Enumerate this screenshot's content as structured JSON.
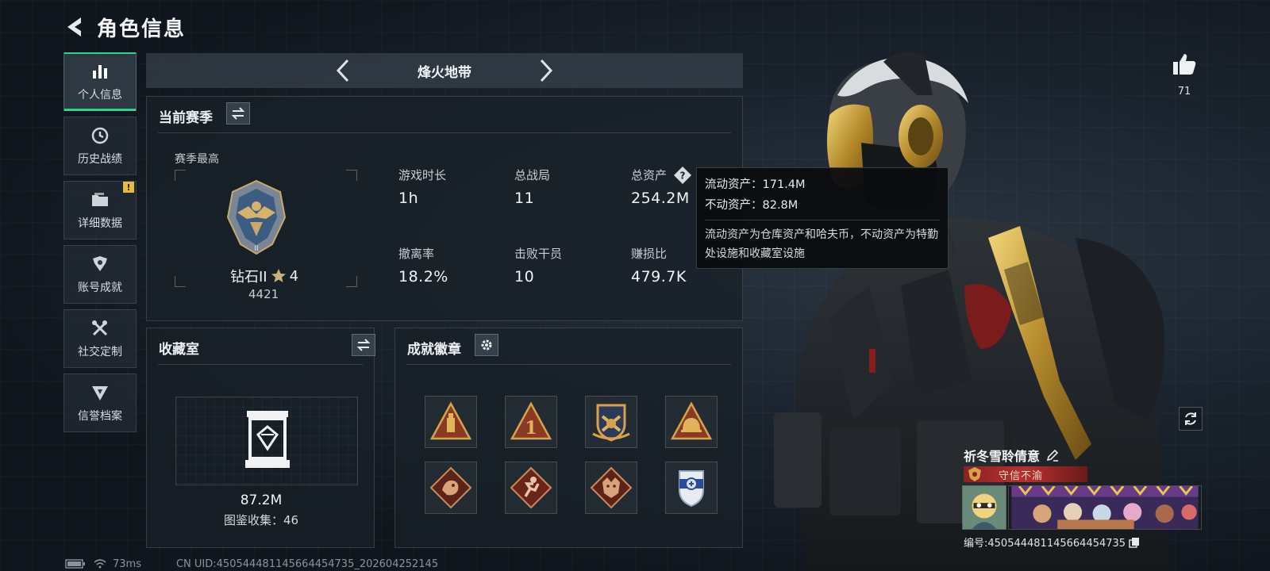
{
  "header": {
    "title": "角色信息"
  },
  "sidebar": {
    "items": [
      {
        "label": "个人信息",
        "icon": "bar-chart-icon"
      },
      {
        "label": "历史战绩",
        "icon": "clock-icon"
      },
      {
        "label": "详细数据",
        "icon": "folder-icon",
        "badge": "!"
      },
      {
        "label": "账号成就",
        "icon": "achievement-icon"
      },
      {
        "label": "社交定制",
        "icon": "tools-icon"
      },
      {
        "label": "信誉档案",
        "icon": "reputation-icon"
      }
    ]
  },
  "mode": {
    "label": "烽火地带"
  },
  "season": {
    "title": "当前赛季",
    "best_label": "赛季最高",
    "rank": {
      "name": "钻石II",
      "stars": "4",
      "score": "4421"
    },
    "stats": [
      {
        "label": "游戏时长",
        "value": "1h"
      },
      {
        "label": "总战局",
        "value": "11"
      },
      {
        "label": "总资产",
        "value": "254.2M"
      },
      {
        "label": "撤离率",
        "value": "18.2%"
      },
      {
        "label": "击败干员",
        "value": "10"
      },
      {
        "label": "赚损比",
        "value": "479.7K"
      }
    ]
  },
  "tooltip": {
    "liquid": "流动资产：171.4M",
    "fixed": "不动资产：82.8M",
    "description": "流动资产为仓库资产和哈夫币，不动资产为特勤处设施和收藏室设施"
  },
  "collection": {
    "title": "收藏室",
    "value": "87.2M",
    "count": "图鉴收集：46"
  },
  "achievements": {
    "title": "成就徽章",
    "badges": [
      "triangle-ammo-badge",
      "triangle-first-badge",
      "crest-shield-badge",
      "triangle-helmet-badge",
      "diamond-dragon-badge",
      "diamond-runner-badge",
      "diamond-wolf-badge",
      "police-shield-badge"
    ]
  },
  "likes": {
    "count": "71"
  },
  "profile": {
    "name": "祈冬雪聆倩意",
    "title": "守信不渝",
    "id": "编号:450544481145664454735"
  },
  "status": {
    "ping": "73ms",
    "uid": "CN UID:450544481145664454735_202604252145"
  },
  "colors": {
    "accent": "#2fd38b",
    "warning": "#e8b93a",
    "banner_red": "#b83030"
  }
}
